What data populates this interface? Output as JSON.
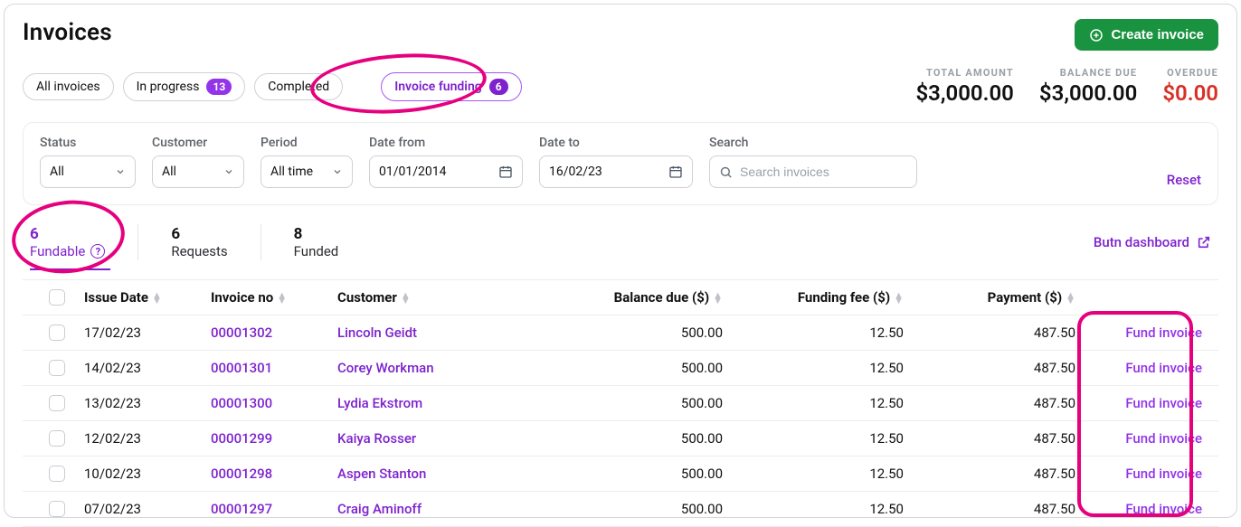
{
  "page": {
    "title": "Invoices"
  },
  "create_button": {
    "label": "Create invoice"
  },
  "pills": {
    "all": "All invoices",
    "in_progress": "In progress",
    "in_progress_badge": "13",
    "completed": "Completed",
    "funding": "Invoice funding",
    "funding_badge": "6"
  },
  "stats": {
    "total_label": "TOTAL AMOUNT",
    "total_value": "$3,000.00",
    "balance_label": "BALANCE DUE",
    "balance_value": "$3,000.00",
    "overdue_label": "OVERDUE",
    "overdue_value": "$0.00"
  },
  "filters": {
    "status_label": "Status",
    "status_value": "All",
    "customer_label": "Customer",
    "customer_value": "All",
    "period_label": "Period",
    "period_value": "All time",
    "date_from_label": "Date from",
    "date_from_value": "01/01/2014",
    "date_to_label": "Date to",
    "date_to_value": "16/02/23",
    "search_label": "Search",
    "search_placeholder": "Search invoices",
    "reset": "Reset"
  },
  "tabs": {
    "fundable_count": "6",
    "fundable_label": "Fundable",
    "requests_count": "6",
    "requests_label": "Requests",
    "funded_count": "8",
    "funded_label": "Funded"
  },
  "butn_link": "Butn dashboard",
  "headers": {
    "issue_date": "Issue Date",
    "invoice_no": "Invoice no",
    "customer": "Customer",
    "balance_due": "Balance due ($)",
    "funding_fee": "Funding fee ($)",
    "payment": "Payment ($)"
  },
  "action_label": "Fund invoice",
  "rows": [
    {
      "date": "17/02/23",
      "invoice": "00001302",
      "customer": "Lincoln Geidt",
      "balance": "500.00",
      "fee": "12.50",
      "payment": "487.50"
    },
    {
      "date": "14/02/23",
      "invoice": "00001301",
      "customer": "Corey Workman",
      "balance": "500.00",
      "fee": "12.50",
      "payment": "487.50"
    },
    {
      "date": "13/02/23",
      "invoice": "00001300",
      "customer": "Lydia Ekstrom",
      "balance": "500.00",
      "fee": "12.50",
      "payment": "487.50"
    },
    {
      "date": "12/02/23",
      "invoice": "00001299",
      "customer": "Kaiya Rosser",
      "balance": "500.00",
      "fee": "12.50",
      "payment": "487.50"
    },
    {
      "date": "10/02/23",
      "invoice": "00001298",
      "customer": "Aspen Stanton",
      "balance": "500.00",
      "fee": "12.50",
      "payment": "487.50"
    },
    {
      "date": "07/02/23",
      "invoice": "00001297",
      "customer": "Craig Aminoff",
      "balance": "500.00",
      "fee": "12.50",
      "payment": "487.50"
    }
  ]
}
